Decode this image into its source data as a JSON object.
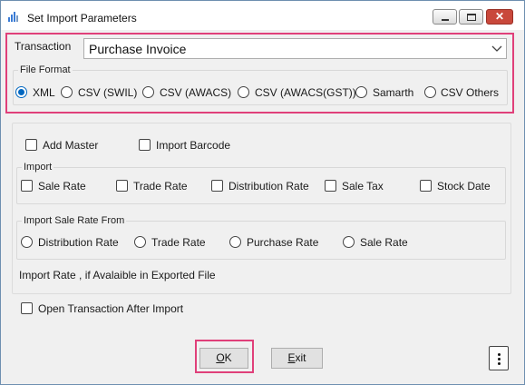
{
  "window": {
    "title": "Set Import Parameters",
    "close_glyph": "✕"
  },
  "transaction": {
    "label": "Transaction",
    "value": "Purchase Invoice"
  },
  "file_format": {
    "label": "File Format",
    "options": [
      "XML",
      "CSV (SWIL)",
      "CSV (AWACS)",
      "CSV (AWACS(GST))",
      "Samarth",
      "CSV Others"
    ],
    "selected": "XML"
  },
  "options": {
    "add_master": "Add Master",
    "import_barcode": "Import Barcode"
  },
  "import_group": {
    "label": "Import",
    "items": [
      "Sale Rate",
      "Trade Rate",
      "Distribution Rate",
      "Sale Tax",
      "Stock Date"
    ]
  },
  "import_sale_rate_from": {
    "label": "Import Sale Rate From",
    "options": [
      "Distribution Rate",
      "Trade Rate",
      "Purchase Rate",
      "Sale Rate"
    ]
  },
  "note": "Import Rate , if Avalaible in Exported File",
  "open_after_import": "Open Transaction After Import",
  "buttons": {
    "ok_accel": "O",
    "ok_rest": "K",
    "exit_accel": "E",
    "exit_rest": "xit"
  },
  "colors": {
    "highlight": "#e0407a",
    "radio_selected": "#0067c0",
    "close_button": "#c9483b"
  }
}
